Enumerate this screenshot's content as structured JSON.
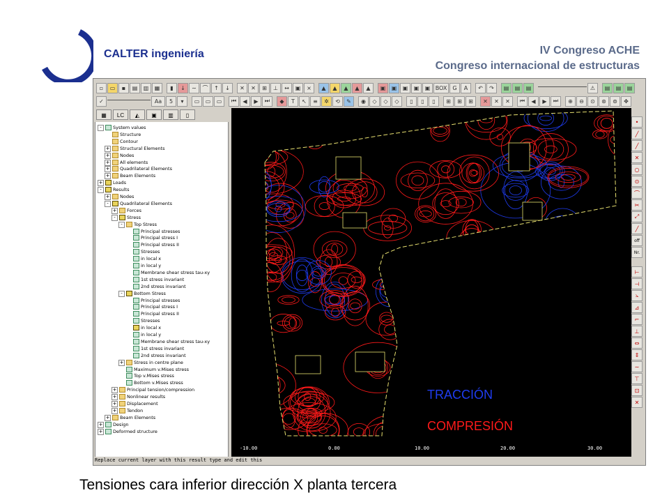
{
  "brand": "CALTER ingeniería",
  "conference": {
    "line1": "IV Congreso ACHE",
    "line2": "Congreso internacional de estructuras"
  },
  "caption": "Tensiones cara inferior dirección X planta tercera",
  "panel_tabs": [
    "",
    "LC",
    "",
    "",
    "",
    ""
  ],
  "tree": [
    {
      "label": "System values",
      "depth": 0,
      "expander": "-",
      "icon": "r"
    },
    {
      "label": "Structure",
      "depth": 1,
      "icon": "f"
    },
    {
      "label": "Contour",
      "depth": 1,
      "icon": "f"
    },
    {
      "label": "Structural Elements",
      "depth": 1,
      "expander": "+",
      "icon": "f"
    },
    {
      "label": "Nodes",
      "depth": 1,
      "expander": "+",
      "icon": "f"
    },
    {
      "label": "All elements",
      "depth": 1,
      "expander": "+",
      "icon": "f"
    },
    {
      "label": "Quadrilateral Elements",
      "depth": 1,
      "expander": "+",
      "icon": "f"
    },
    {
      "label": "Beam Elements",
      "depth": 1,
      "expander": "+",
      "icon": "f"
    },
    {
      "label": "Loads",
      "depth": 0,
      "expander": "+",
      "icon": "sel"
    },
    {
      "label": "Results",
      "depth": 0,
      "expander": "-",
      "icon": "sel"
    },
    {
      "label": "Nodes",
      "depth": 1,
      "expander": "+",
      "icon": "f"
    },
    {
      "label": "Quadrilateral Elements",
      "depth": 1,
      "expander": "-",
      "icon": "sel"
    },
    {
      "label": "Forces",
      "depth": 2,
      "expander": "+",
      "icon": "f"
    },
    {
      "label": "Stress",
      "depth": 2,
      "expander": "-",
      "icon": "sel"
    },
    {
      "label": "Top Stress",
      "depth": 3,
      "expander": "-",
      "icon": "f"
    },
    {
      "label": "Principal stresses",
      "depth": 4,
      "icon": "r"
    },
    {
      "label": "Principal stress I",
      "depth": 4,
      "icon": "r"
    },
    {
      "label": "Principal stress II",
      "depth": 4,
      "icon": "r"
    },
    {
      "label": "Stresses",
      "depth": 4,
      "icon": "r"
    },
    {
      "label": "in local x",
      "depth": 4,
      "icon": "r"
    },
    {
      "label": "in local y",
      "depth": 4,
      "icon": "r"
    },
    {
      "label": "Membrane shear stress tau-xy",
      "depth": 4,
      "icon": "r"
    },
    {
      "label": "1st stress invariant",
      "depth": 4,
      "icon": "r"
    },
    {
      "label": "2nd stress invariant",
      "depth": 4,
      "icon": "r"
    },
    {
      "label": "Bottom Stress",
      "depth": 3,
      "expander": "-",
      "icon": "sel"
    },
    {
      "label": "Principal stresses",
      "depth": 4,
      "icon": "r"
    },
    {
      "label": "Principal stress I",
      "depth": 4,
      "icon": "r"
    },
    {
      "label": "Principal stress II",
      "depth": 4,
      "icon": "r"
    },
    {
      "label": "Stresses",
      "depth": 4,
      "icon": "r"
    },
    {
      "label": "in local x",
      "depth": 4,
      "icon": "sel"
    },
    {
      "label": "in local y",
      "depth": 4,
      "icon": "r"
    },
    {
      "label": "Membrane shear stress tau-xy",
      "depth": 4,
      "icon": "r"
    },
    {
      "label": "1st stress invariant",
      "depth": 4,
      "icon": "r"
    },
    {
      "label": "2nd stress invariant",
      "depth": 4,
      "icon": "r"
    },
    {
      "label": "Stress in centre plane",
      "depth": 3,
      "expander": "+",
      "icon": "f"
    },
    {
      "label": "Maximum v.Mises stress",
      "depth": 3,
      "icon": "r"
    },
    {
      "label": "Top v.Mises stress",
      "depth": 3,
      "icon": "r"
    },
    {
      "label": "Bottom v.Mises stress",
      "depth": 3,
      "icon": "r"
    },
    {
      "label": "Principal tension/compression",
      "depth": 2,
      "expander": "+",
      "icon": "f"
    },
    {
      "label": "Nonlinear results",
      "depth": 2,
      "expander": "+",
      "icon": "f"
    },
    {
      "label": "Displacement",
      "depth": 2,
      "expander": "+",
      "icon": "f"
    },
    {
      "label": "Tendon",
      "depth": 2,
      "expander": "+",
      "icon": "f"
    },
    {
      "label": "Beam Elements",
      "depth": 1,
      "expander": "+",
      "icon": "f"
    },
    {
      "label": "Design",
      "depth": 0,
      "expander": "+",
      "icon": "r"
    },
    {
      "label": "Deformed structure",
      "depth": 0,
      "expander": "+",
      "icon": "r"
    }
  ],
  "toolbar": {
    "aa_label": "Aa",
    "box_label": "BOX"
  },
  "right_tools": {
    "off": "off",
    "nr": "Nr."
  },
  "axis_labels": [
    "-10.00",
    "0.00",
    "10.00",
    "20.00",
    "30.00"
  ],
  "legend": {
    "traccion": "TRACCIÓN",
    "compresion": "COMPRESIÓN"
  },
  "colors": {
    "tension": "#1f3cf0",
    "compression": "#ff1a1a",
    "viewport_bg": "#000000",
    "brand": "#1b2f8f"
  },
  "status_text": "Replace current layer with this result type and edit this"
}
